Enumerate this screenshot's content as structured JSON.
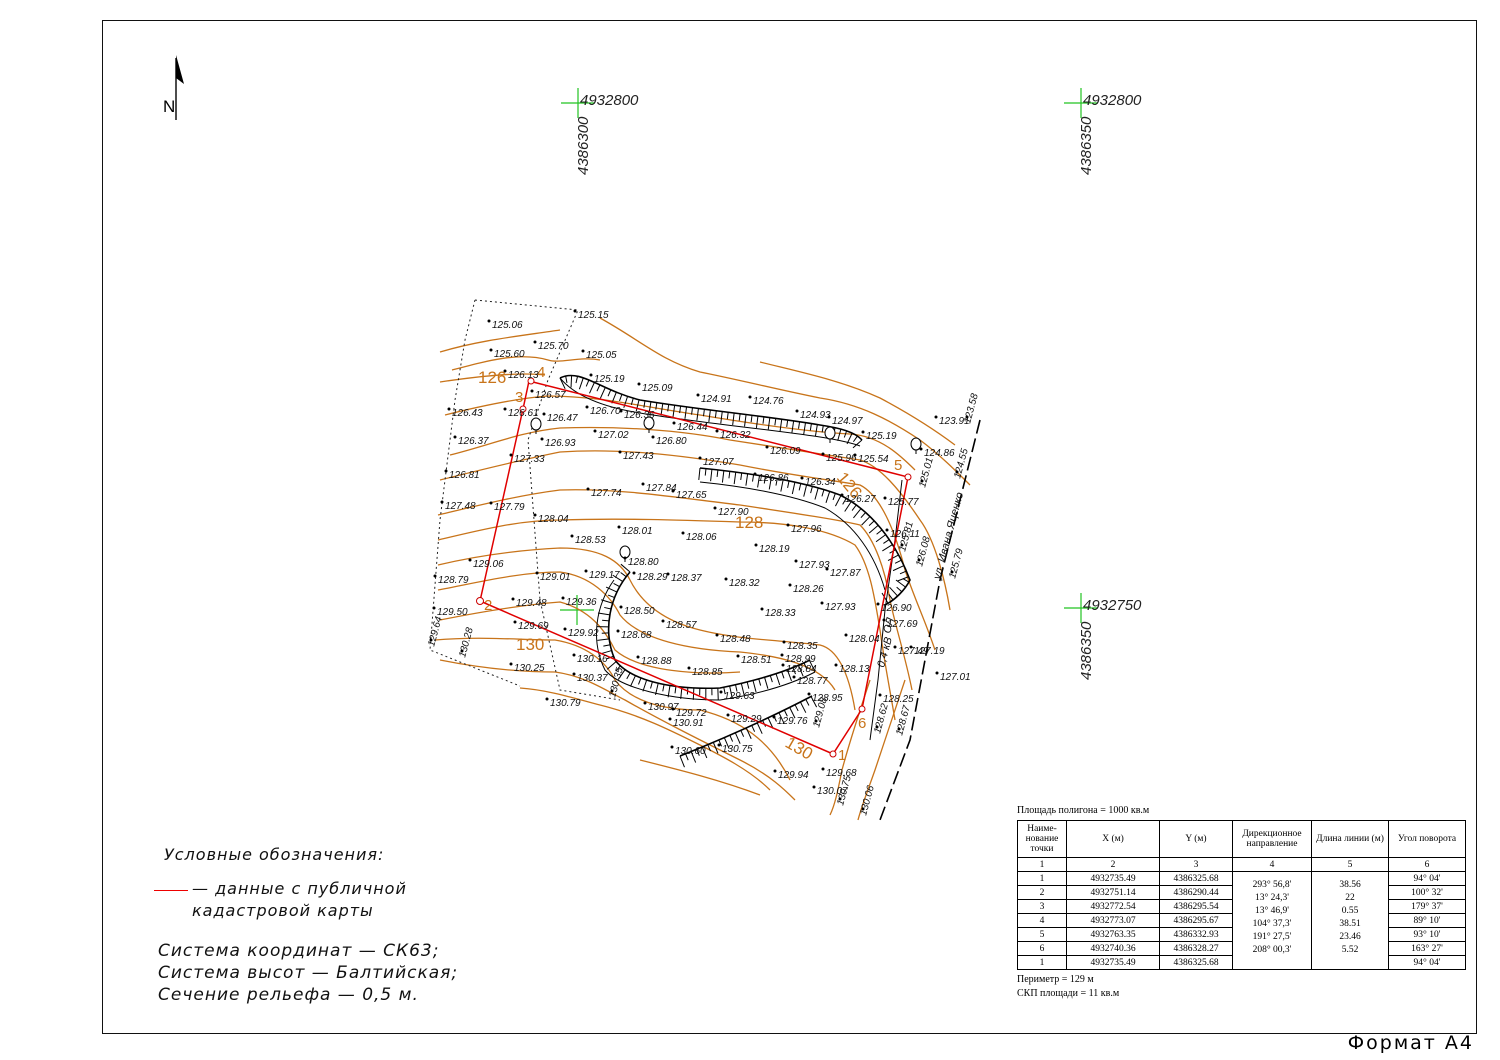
{
  "sheet": {
    "format_label": "Формат А4"
  },
  "north_arrow": {
    "label": "N"
  },
  "grid": {
    "labels": [
      "4932800",
      "4386300",
      "4932800",
      "4386350",
      "4932750",
      "4386350"
    ]
  },
  "legend": {
    "title": "Условные обозначения:",
    "red_line_desc": "— данные с публичной кадастровой карты",
    "coord_system": "Система координат — СК63;",
    "height_system": "Система высот — Балтийская;",
    "relief_section": "Сечение рельефа — 0,5 м."
  },
  "contours": {
    "labels": [
      "126",
      "126",
      "128",
      "130",
      "130"
    ]
  },
  "parcel": {
    "point_numbers": [
      "1",
      "2",
      "3",
      "4",
      "5",
      "6"
    ],
    "color": "#e00000"
  },
  "street_labels": [
    "ул. Ивана Яценко",
    "0,4 кВ",
    "ОЛ"
  ],
  "elevations": [
    "125.15",
    "125.06",
    "125.70",
    "125.05",
    "125.60",
    "126.13",
    "125.19",
    "125.09",
    "124.91",
    "124.76",
    "124.93",
    "124.97",
    "125.19",
    "126.43",
    "126.61",
    "126.57",
    "126.47",
    "126.70",
    "126.36",
    "126.44",
    "126.32",
    "126.80",
    "126.37",
    "126.93",
    "127.02",
    "127.43",
    "127.07",
    "126.09",
    "125.96",
    "125.54",
    "127.33",
    "126.81",
    "126.86",
    "126.34",
    "126.27",
    "125.77",
    "124.86",
    "123.91",
    "123.58",
    "125.01",
    "124.55",
    "127.74",
    "127.84",
    "127.65",
    "127.48",
    "127.79",
    "128.04",
    "127.90",
    "128.01",
    "128.06",
    "127.96",
    "126.11",
    "128.53",
    "128.19",
    "125.81",
    "126.08",
    "125.79",
    "128.80",
    "129.06",
    "129.01",
    "129.17",
    "128.29",
    "128.37",
    "128.32",
    "127.93",
    "128.26",
    "127.87",
    "128.79",
    "129.48",
    "129.36",
    "128.33",
    "127.93",
    "126.90",
    "129.50",
    "128.50",
    "128.57",
    "128.68",
    "128.48",
    "128.04",
    "127.69",
    "129.69",
    "129.92",
    "128.35",
    "127.49",
    "127.19",
    "129.64",
    "130.28",
    "130.16",
    "128.99",
    "128.84",
    "128.13",
    "130.25",
    "128.88",
    "128.85",
    "128.51",
    "128.77",
    "130.37",
    "129.63",
    "128.95",
    "128.25",
    "130.35",
    "130.97",
    "129.29",
    "127.01",
    "130.79",
    "130.91",
    "129.72",
    "129.76",
    "129.08",
    "128.62",
    "130.60",
    "130.75",
    "128.67",
    "129.94",
    "129.68",
    "130.07",
    "130.75",
    "130.06"
  ],
  "table": {
    "area_caption": "Площадь полигона = 1000 кв.м",
    "headers": [
      "Наиме- нование точки",
      "X (м)",
      "Y (м)",
      "Дирекционное направление",
      "Длина линии (м)",
      "Угол поворота"
    ],
    "col_numbers": [
      "1",
      "2",
      "3",
      "4",
      "5",
      "6"
    ],
    "rows": [
      {
        "n": "1",
        "x": "4932735.49",
        "y": "4386325.68",
        "angle": "94°  04'"
      },
      {
        "n": "2",
        "x": "4932751.14",
        "y": "4386290.44",
        "angle": "100° 32'"
      },
      {
        "n": "3",
        "x": "4932772.54",
        "y": "4386295.54",
        "angle": "179° 37'"
      },
      {
        "n": "4",
        "x": "4932773.07",
        "y": "4386295.67",
        "angle": "89° 10'"
      },
      {
        "n": "5",
        "x": "4932763.35",
        "y": "4386332.93",
        "angle": "93° 10'"
      },
      {
        "n": "6",
        "x": "4932740.36",
        "y": "4386328.27",
        "angle": "163° 27'"
      },
      {
        "n": "1",
        "x": "4932735.49",
        "y": "4386325.68",
        "angle": "94°  04'"
      }
    ],
    "directions": [
      "293° 56,8'",
      "13° 24,3'",
      "13° 46,9'",
      "104° 37,3'",
      "191° 27,5'",
      "208° 00,3'"
    ],
    "lengths": [
      "38.56",
      "22",
      "0.55",
      "38.51",
      "23.46",
      "5.52"
    ],
    "perimeter": "Периметр = 129 м",
    "skp": "СКП площади = 11 кв.м"
  }
}
